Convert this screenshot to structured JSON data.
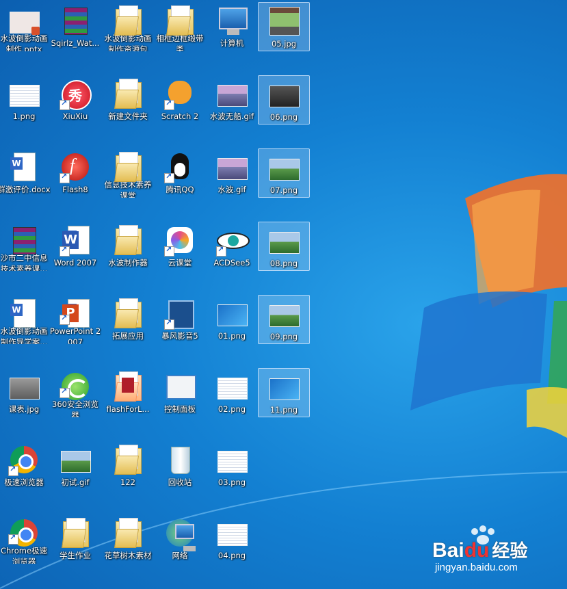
{
  "desktop": {
    "icons": [
      {
        "label": "水波倒影动画制作.pptx",
        "type": "pptx-thumb",
        "shortcut": false,
        "selected": false
      },
      {
        "label": "Sqirlz_Wat...",
        "type": "winrar",
        "shortcut": false,
        "selected": false
      },
      {
        "label": "水波倒影动画制作资源包",
        "type": "folder",
        "shortcut": false,
        "selected": false
      },
      {
        "label": "相框边框缎带类",
        "type": "folder",
        "shortcut": false,
        "selected": false
      },
      {
        "label": "计算机",
        "type": "computer",
        "shortcut": false,
        "selected": false
      },
      {
        "label": "05.jpg",
        "type": "image-photo",
        "shortcut": false,
        "selected": true
      },
      {
        "label": "1.png",
        "type": "image-list",
        "shortcut": false,
        "selected": false
      },
      {
        "label": "XiuXiu",
        "type": "xiuxiu",
        "shortcut": true,
        "selected": false
      },
      {
        "label": "新建文件夹",
        "type": "folder",
        "shortcut": false,
        "selected": false
      },
      {
        "label": "Scratch 2",
        "type": "scratch",
        "shortcut": true,
        "selected": false
      },
      {
        "label": "水波无船.gif",
        "type": "image-sunset",
        "shortcut": false,
        "selected": false
      },
      {
        "label": "06.png",
        "type": "image-dark",
        "shortcut": false,
        "selected": true
      },
      {
        "label": "群激评价.docx",
        "type": "word-doc",
        "shortcut": false,
        "selected": false
      },
      {
        "label": "Flash8",
        "type": "flash",
        "shortcut": true,
        "selected": false
      },
      {
        "label": "信息技术素养课堂",
        "type": "folder",
        "shortcut": false,
        "selected": false
      },
      {
        "label": "腾讯QQ",
        "type": "qq",
        "shortcut": true,
        "selected": false
      },
      {
        "label": "水波.gif",
        "type": "image-sunset",
        "shortcut": false,
        "selected": false
      },
      {
        "label": "07.png",
        "type": "image-land",
        "shortcut": false,
        "selected": true
      },
      {
        "label": "沙市二中信息技术素养课...",
        "type": "winrar",
        "shortcut": false,
        "selected": false
      },
      {
        "label": "Word 2007",
        "type": "word-app",
        "shortcut": true,
        "selected": false
      },
      {
        "label": "水波制作器",
        "type": "folder",
        "shortcut": false,
        "selected": false
      },
      {
        "label": "云课堂",
        "type": "cloud",
        "shortcut": true,
        "selected": false
      },
      {
        "label": "ACDSee5",
        "type": "acdsee",
        "shortcut": true,
        "selected": false
      },
      {
        "label": "08.png",
        "type": "image-land",
        "shortcut": false,
        "selected": true
      },
      {
        "label": "水波倒影动画制作导学案...",
        "type": "word-doc",
        "shortcut": false,
        "selected": false
      },
      {
        "label": "PowerPoint 2007",
        "type": "ppt-app",
        "shortcut": true,
        "selected": false
      },
      {
        "label": "拓展应用",
        "type": "folder",
        "shortcut": false,
        "selected": false
      },
      {
        "label": "暴风影音5",
        "type": "film",
        "shortcut": true,
        "selected": false
      },
      {
        "label": "01.png",
        "type": "image-win",
        "shortcut": false,
        "selected": false
      },
      {
        "label": "09.png",
        "type": "image-land",
        "shortcut": false,
        "selected": true
      },
      {
        "label": "课表.jpg",
        "type": "image-gray",
        "shortcut": false,
        "selected": false
      },
      {
        "label": "360安全浏览器",
        "type": "browser360",
        "shortcut": true,
        "selected": false
      },
      {
        "label": "flashForL...",
        "type": "folder-red",
        "shortcut": false,
        "selected": false
      },
      {
        "label": "控制面板",
        "type": "control-panel",
        "shortcut": false,
        "selected": false
      },
      {
        "label": "02.png",
        "type": "image-list",
        "shortcut": false,
        "selected": false
      },
      {
        "label": "11.png",
        "type": "image-win",
        "shortcut": false,
        "selected": true
      },
      {
        "label": "极速浏览器",
        "type": "chrome",
        "shortcut": true,
        "selected": false
      },
      {
        "label": "初试.gif",
        "type": "image-land",
        "shortcut": false,
        "selected": false
      },
      {
        "label": "122",
        "type": "folder",
        "shortcut": false,
        "selected": false
      },
      {
        "label": "回收站",
        "type": "recycle-bin",
        "shortcut": false,
        "selected": false
      },
      {
        "label": "03.png",
        "type": "image-list",
        "shortcut": false,
        "selected": false
      },
      {
        "label": "Chrome极速浏览器",
        "type": "chrome",
        "shortcut": true,
        "selected": false
      },
      {
        "label": "学生作业",
        "type": "folder",
        "shortcut": false,
        "selected": false
      },
      {
        "label": "花草树木素材",
        "type": "folder",
        "shortcut": false,
        "selected": false
      },
      {
        "label": "网络",
        "type": "network",
        "shortcut": false,
        "selected": false
      },
      {
        "label": "04.png",
        "type": "image-list",
        "shortcut": false,
        "selected": false
      }
    ]
  },
  "watermark": {
    "brand": "Bai",
    "brand2": "du",
    "suffix": "经验",
    "url": "jingyan.baidu.com"
  },
  "colors": {
    "desktop": "#1380d2",
    "selection": "#c8e1fa",
    "label": "#ffffff"
  }
}
